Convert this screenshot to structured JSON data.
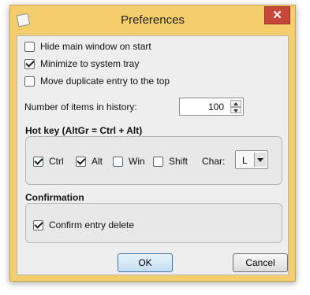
{
  "window": {
    "title": "Preferences",
    "close_glyph": "✕",
    "app_icon": "preferences-icon"
  },
  "options": {
    "hide_main_window": {
      "label": "Hide main window on start",
      "checked": false
    },
    "minimize_to_tray": {
      "label": "Minimize to system tray",
      "checked": true
    },
    "move_duplicate": {
      "label": "Move duplicate entry to the top",
      "checked": false
    }
  },
  "history": {
    "label": "Number of items in history:",
    "value": "100"
  },
  "hotkey": {
    "title": "Hot key (AltGr = Ctrl + Alt)",
    "ctrl": {
      "label": "Ctrl",
      "checked": true
    },
    "alt": {
      "label": "Alt",
      "checked": true
    },
    "win": {
      "label": "Win",
      "checked": false
    },
    "shift": {
      "label": "Shift",
      "checked": false
    },
    "char_label": "Char:",
    "char_value": "L"
  },
  "confirmation": {
    "title": "Confirmation",
    "confirm_delete": {
      "label": "Confirm entry delete",
      "checked": true
    }
  },
  "buttons": {
    "ok": "OK",
    "cancel": "Cancel"
  }
}
